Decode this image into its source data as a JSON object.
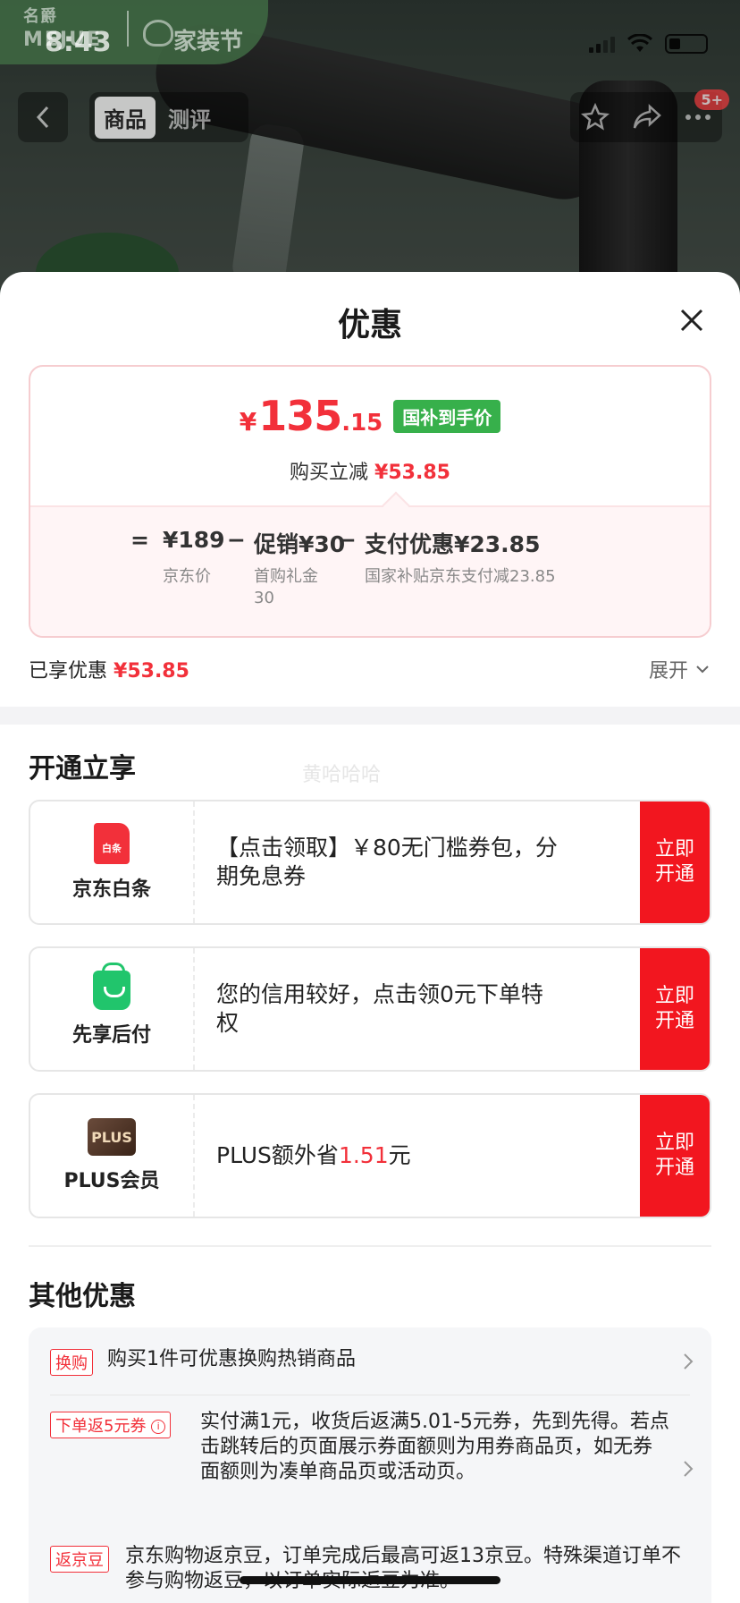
{
  "status_bar": {
    "time": "8:43"
  },
  "brand": {
    "name_top": "名爵",
    "name_bottom": "MEJUE",
    "event": "家装节"
  },
  "nav": {
    "tabs": [
      {
        "label": "商品",
        "active": true
      },
      {
        "label": "测评",
        "active": false
      }
    ],
    "badge": "5+"
  },
  "sheet": {
    "title": "优惠",
    "price": {
      "currency": "¥",
      "integer": "135",
      "decimal": ".15",
      "tag": "国补到手价",
      "subtitle_prefix": "购买立减",
      "subtitle_amount": "¥53.85"
    },
    "formula": {
      "equals": "=",
      "base_value": "¥189",
      "base_label": "京东价",
      "minus1": "−",
      "promo_value": "促销¥30",
      "promo_label": "首购礼金30",
      "minus2": "−",
      "pay_value": "支付优惠¥23.85",
      "pay_label": "国家补贴京东支付减23.85"
    },
    "enjoyed_label": "已享优惠",
    "enjoyed_amount": "¥53.85",
    "expand_label": "展开"
  },
  "open_section": {
    "title": "开通立享",
    "watermark": "黄哈哈哈",
    "cards": [
      {
        "icon": "baitiao-icon",
        "icon_text": "白条",
        "label": "京东白条",
        "desc": "【点击领取】￥80无门槛券包，分期免息券",
        "button": "立即开通"
      },
      {
        "icon": "shopping-bag-icon",
        "label": "先享后付",
        "desc": "您的信用较好，点击领0元下单特权",
        "button": "立即开通"
      },
      {
        "icon": "plus-icon",
        "icon_text": "PLUS",
        "label": "PLUS会员",
        "desc_prefix": "PLUS额外省",
        "desc_amount": "1.51",
        "desc_suffix": "元",
        "button": "立即开通"
      }
    ]
  },
  "other_section": {
    "title": "其他优惠",
    "rows": [
      {
        "tag": "换购",
        "text": "购买1件可优惠换购热销商品"
      },
      {
        "tag": "下单返5元券",
        "text": "实付满1元，收货后返满5.01-5元券，先到先得。若点击跳转后的页面展示券面额则为用券商品页，如无券面额则为凑单商品页或活动页。"
      },
      {
        "tag": "返京豆",
        "text": "京东购物返京豆，订单完成后最高可返13京豆。特殊渠道订单不参与购物返豆，以订单实际返豆为准。"
      }
    ]
  },
  "colors": {
    "accent_red": "#f2303a",
    "button_red": "#f2161f",
    "green_tag": "#37b04b"
  }
}
